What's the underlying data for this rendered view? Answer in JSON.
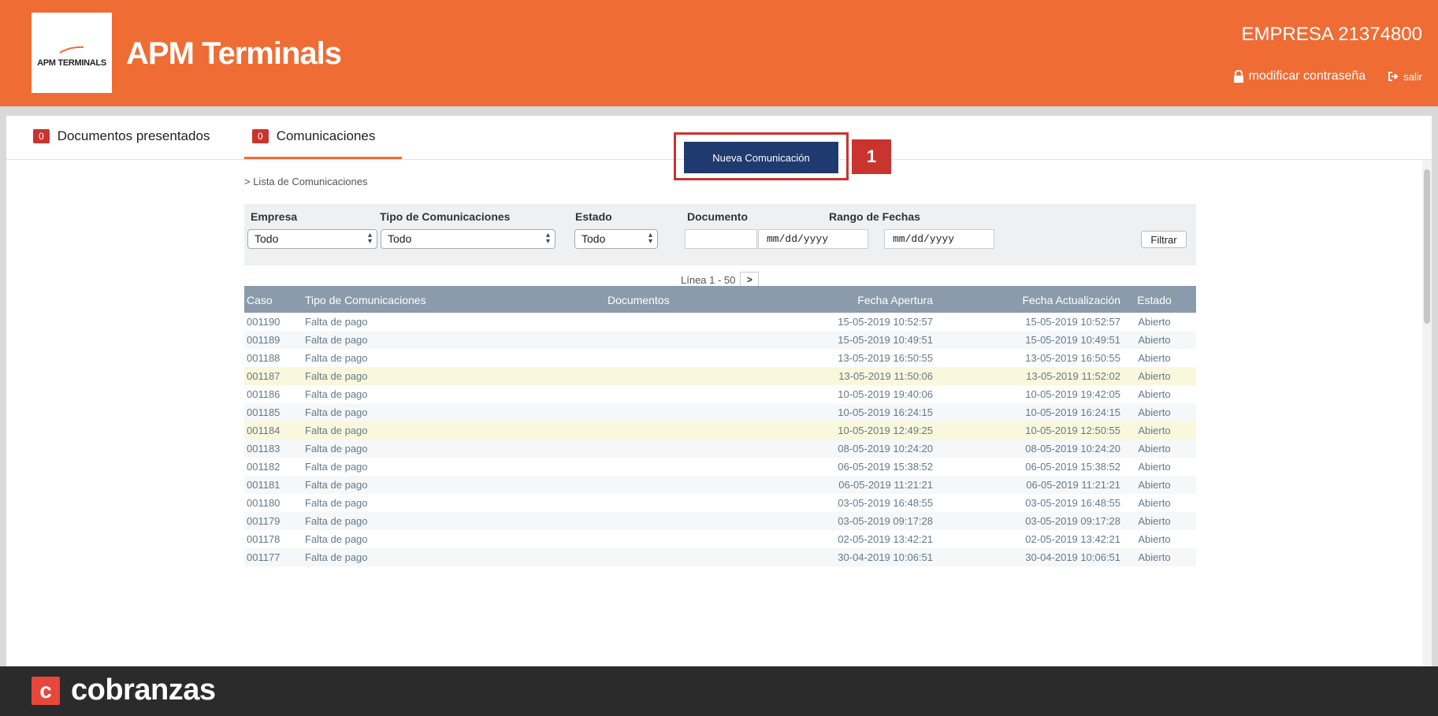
{
  "header": {
    "logo_small_text": "APM TERMINALS",
    "brand_title": "APM Terminals",
    "company": "EMPRESA 21374800",
    "change_password": "modificar contraseña",
    "logout": "salir"
  },
  "tabs": [
    {
      "count": "0",
      "label": "Documentos presentados"
    },
    {
      "count": "0",
      "label": "Comunicaciones"
    }
  ],
  "breadcrumb": "> Lista de Comunicaciones",
  "new_button": "Nueva Comunicación",
  "step_badge": "1",
  "filters": {
    "empresa_label": "Empresa",
    "tipo_label": "Tipo de Comunicaciones",
    "estado_label": "Estado",
    "documento_label": "Documento",
    "rango_label": "Rango de Fechas",
    "empresa_value": "Todo",
    "tipo_value": "Todo",
    "estado_value": "Todo",
    "date_placeholder": "mm/dd/yyyy",
    "filter_button": "Filtrar"
  },
  "pager": {
    "label": "Línea 1 - 50",
    "next": ">"
  },
  "table": {
    "headers": [
      "Caso",
      "Tipo de Comunicaciones",
      "Documentos",
      "Fecha Apertura",
      "Fecha Actualización",
      "Estado"
    ],
    "rows": [
      {
        "caso": "001190",
        "tipo": "Falta de pago",
        "docs": "",
        "apertura": "15-05-2019 10:52:57",
        "actualizacion": "15-05-2019 10:52:57",
        "estado": "Abierto"
      },
      {
        "caso": "001189",
        "tipo": "Falta de pago",
        "docs": "",
        "apertura": "15-05-2019 10:49:51",
        "actualizacion": "15-05-2019 10:49:51",
        "estado": "Abierto"
      },
      {
        "caso": "001188",
        "tipo": "Falta de pago",
        "docs": "",
        "apertura": "13-05-2019 16:50:55",
        "actualizacion": "13-05-2019 16:50:55",
        "estado": "Abierto"
      },
      {
        "caso": "001187",
        "tipo": "Falta de pago",
        "docs": "",
        "apertura": "13-05-2019 11:50:06",
        "actualizacion": "13-05-2019 11:52:02",
        "estado": "Abierto"
      },
      {
        "caso": "001186",
        "tipo": "Falta de pago",
        "docs": "",
        "apertura": "10-05-2019 19:40:06",
        "actualizacion": "10-05-2019 19:42:05",
        "estado": "Abierto"
      },
      {
        "caso": "001185",
        "tipo": "Falta de pago",
        "docs": "",
        "apertura": "10-05-2019 16:24:15",
        "actualizacion": "10-05-2019 16:24:15",
        "estado": "Abierto"
      },
      {
        "caso": "001184",
        "tipo": "Falta de pago",
        "docs": "",
        "apertura": "10-05-2019 12:49:25",
        "actualizacion": "10-05-2019 12:50:55",
        "estado": "Abierto"
      },
      {
        "caso": "001183",
        "tipo": "Falta de pago",
        "docs": "",
        "apertura": "08-05-2019 10:24:20",
        "actualizacion": "08-05-2019 10:24:20",
        "estado": "Abierto"
      },
      {
        "caso": "001182",
        "tipo": "Falta de pago",
        "docs": "",
        "apertura": "06-05-2019 15:38:52",
        "actualizacion": "06-05-2019 15:38:52",
        "estado": "Abierto"
      },
      {
        "caso": "001181",
        "tipo": "Falta de pago",
        "docs": "",
        "apertura": "06-05-2019 11:21:21",
        "actualizacion": "06-05-2019 11:21:21",
        "estado": "Abierto"
      },
      {
        "caso": "001180",
        "tipo": "Falta de pago",
        "docs": "",
        "apertura": "03-05-2019 16:48:55",
        "actualizacion": "03-05-2019 16:48:55",
        "estado": "Abierto"
      },
      {
        "caso": "001179",
        "tipo": "Falta de pago",
        "docs": "",
        "apertura": "03-05-2019 09:17:28",
        "actualizacion": "03-05-2019 09:17:28",
        "estado": "Abierto"
      },
      {
        "caso": "001178",
        "tipo": "Falta de pago",
        "docs": "",
        "apertura": "02-05-2019 13:42:21",
        "actualizacion": "02-05-2019 13:42:21",
        "estado": "Abierto"
      },
      {
        "caso": "001177",
        "tipo": "Falta de pago",
        "docs": "",
        "apertura": "30-04-2019 10:06:51",
        "actualizacion": "30-04-2019 10:06:51",
        "estado": "Abierto"
      }
    ]
  },
  "footer": {
    "icon_letter": "c",
    "brand": "cobranzas"
  },
  "colors": {
    "header": "#ef6c34",
    "badge": "#c9342f",
    "button": "#1f3a6e",
    "table_header": "#8b9bac",
    "highlight_row": "#faf8dc",
    "footer": "#2b2b2b"
  }
}
